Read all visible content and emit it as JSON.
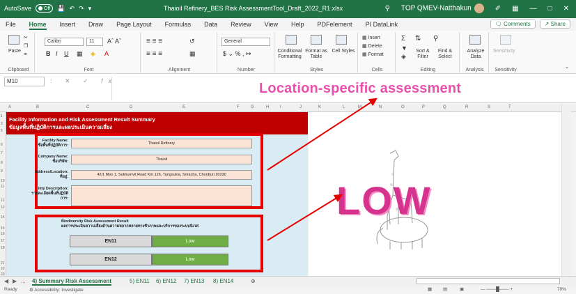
{
  "titlebar": {
    "autosave_label": "AutoSave",
    "autosave_state": "Off",
    "file_title": "Thaioil Refinery_BES Risk AssessmentTool_Draft_2022_R1.xlsx",
    "user_name": "TOP QMEV-Natthakun"
  },
  "menu": {
    "tabs": [
      "File",
      "Home",
      "Insert",
      "Draw",
      "Page Layout",
      "Formulas",
      "Data",
      "Review",
      "View",
      "Help",
      "PDFelement",
      "PI DataLink"
    ],
    "active_tab": "Home",
    "comments_label": "Comments",
    "share_label": "Share"
  },
  "ribbon": {
    "clipboard": {
      "label": "Clipboard",
      "paste": "Paste"
    },
    "font": {
      "label": "Font",
      "name": "Calibri",
      "size": "11"
    },
    "alignment": {
      "label": "Alignment"
    },
    "number": {
      "label": "Number",
      "format": "General"
    },
    "styles": {
      "label": "Styles",
      "conditional": "Conditional Formatting",
      "format_table": "Format as Table",
      "cell_styles": "Cell Styles"
    },
    "cells": {
      "label": "Cells",
      "insert": "Insert",
      "delete": "Delete",
      "format": "Format"
    },
    "editing": {
      "label": "Editing",
      "sort": "Sort & Filter",
      "find": "Find & Select"
    },
    "analysis": {
      "label": "Analysis",
      "analyze": "Analyze Data"
    },
    "sensitivity": {
      "label": "Sensitivity",
      "button": "Sensitivity"
    }
  },
  "formula_bar": {
    "name_box": "M10",
    "fx": "fx"
  },
  "overlay": {
    "title": "Location-specific assessment",
    "low_label": "LOW"
  },
  "columns": [
    "A",
    "B",
    "C",
    "D",
    "E",
    "F",
    "G",
    "H",
    "I",
    "J",
    "K",
    "L",
    "M",
    "N",
    "O",
    "P",
    "Q",
    "R",
    "S",
    "T"
  ],
  "rows": [
    "1",
    "3",
    "5",
    "6",
    "7",
    "8",
    "9",
    "10",
    "11",
    "12",
    "13",
    "14",
    "15",
    "16",
    "17",
    "18",
    "21",
    "22",
    "23"
  ],
  "sheet": {
    "header_en": "Facility Information and Risk Assessment Result Summary",
    "header_th": "ข้อมูลพื้นที่ปฏิบัติการและผลประเมินความเสี่ยง",
    "fields": [
      {
        "label_en": "Facility Name:",
        "label_th": "ชื่อพื้นที่ปฏิบัติการ:",
        "value": "Thaioil Refinery"
      },
      {
        "label_en": "Company Name:",
        "label_th": "ชื่อบริษัท:",
        "value": "Thaioil"
      },
      {
        "label_en": "Address/Location:",
        "label_th": "ที่อยู่:",
        "value": "42/1 Moo 1, Sukhumvit Road Km.126, Tungsukla, Sriracha, Chonburi 20230"
      },
      {
        "label_en": "ility Description:",
        "label_th": "รายละเอียดพื้นที่ปฏิบัติการ:",
        "value": ""
      }
    ],
    "bio_title_en": "Biodiversity Risk Assessment Result",
    "bio_title_th": "ผลการประเมินความเสี่ยงด้านความหลากหลายทางชีวภาพและบริการของระบบนิเวศ",
    "results": [
      {
        "name": "EN11",
        "value": "Low"
      },
      {
        "name": "EN12",
        "value": "Low"
      }
    ]
  },
  "sheet_tabs": [
    "...",
    "4) Summary Risk Assessment",
    "5) EN11",
    "6) EN12",
    "7) EN13",
    "8) EN14"
  ],
  "active_sheet": "4) Summary Risk Assessment",
  "status": {
    "ready": "Ready",
    "accessibility": "Accessibility: Investigate",
    "zoom": "70%"
  },
  "colors": {
    "excel_green": "#217346",
    "header_red": "#c00000",
    "box_red": "#e60000",
    "value_fill": "#fbe4d5",
    "low_green": "#70ad47",
    "overlay_pink": "#ea4fae"
  }
}
